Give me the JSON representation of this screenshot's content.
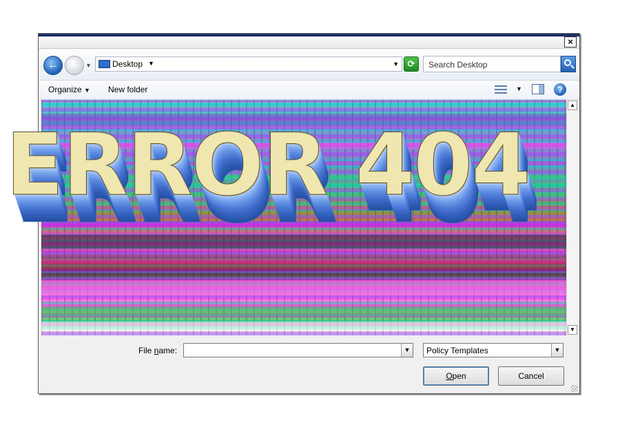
{
  "dialog": {
    "close_label": "×"
  },
  "navigation": {
    "back_glyph": "←",
    "forward_glyph": "→",
    "address": "Desktop",
    "search_placeholder": "Search Desktop"
  },
  "toolbar": {
    "organize_label": "Organize",
    "new_folder_label": "New folder",
    "help_glyph": "?"
  },
  "footer": {
    "file_name_label_prefix": "File ",
    "file_name_label_underlined": "n",
    "file_name_label_suffix": "ame:",
    "file_name_value": "",
    "file_type_value": "Policy Templates",
    "open_label_underlined": "O",
    "open_label_rest": "pen",
    "cancel_label": "Cancel"
  },
  "overlay": {
    "error_text": "ERROR 404"
  },
  "colors": {
    "title_strip": "#1b2f6b",
    "overlay_text": "#efe6b0",
    "overlay_extrusion": "#4a78d4"
  }
}
